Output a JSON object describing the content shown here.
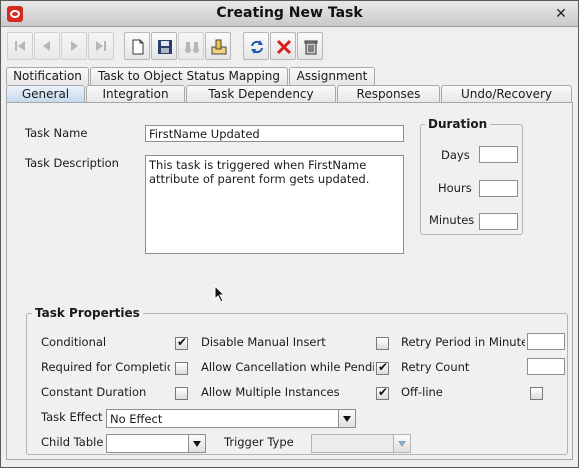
{
  "window": {
    "title": "Creating New Task"
  },
  "toolbar": {
    "buttons": [
      {
        "icon": "first-record-icon"
      },
      {
        "icon": "previous-record-icon"
      },
      {
        "icon": "next-record-icon"
      },
      {
        "icon": "last-record-icon"
      },
      {
        "icon": "new-document-icon"
      },
      {
        "icon": "save-icon"
      },
      {
        "icon": "find-binoculars-icon"
      },
      {
        "icon": "edit-icon"
      },
      {
        "icon": "refresh-icon"
      },
      {
        "icon": "cancel-x-icon"
      },
      {
        "icon": "delete-trash-icon"
      }
    ]
  },
  "tabs": {
    "top_row": [
      "Notification",
      "Task to Object Status Mapping",
      "Assignment"
    ],
    "bottom_row": [
      "General",
      "Integration",
      "Task Dependency",
      "Responses",
      "Undo/Recovery"
    ],
    "active": "General"
  },
  "general": {
    "task_name_label": "Task Name",
    "task_name_value": "FirstName Updated",
    "task_description_label": "Task Description",
    "task_description_value": "This task is triggered when FirstName attribute of parent form gets updated."
  },
  "duration": {
    "title": "Duration",
    "days_label": "Days",
    "hours_label": "Hours",
    "minutes_label": "Minutes",
    "days_value": "",
    "hours_value": "",
    "minutes_value": ""
  },
  "task_properties": {
    "title": "Task Properties",
    "conditional_label": "Conditional",
    "conditional_checked": true,
    "required_label": "Required for Completion",
    "required_checked": false,
    "constant_duration_label": "Constant Duration",
    "constant_duration_checked": false,
    "disable_manual_insert_label": "Disable Manual Insert",
    "disable_manual_insert_checked": false,
    "allow_cancellation_label": "Allow Cancellation while Pending",
    "allow_cancellation_checked": true,
    "allow_multiple_label": "Allow Multiple Instances",
    "allow_multiple_checked": true,
    "retry_period_label": "Retry Period in Minutes",
    "retry_period_value": "",
    "retry_count_label": "Retry Count",
    "retry_count_value": "",
    "offline_label": "Off-line",
    "offline_checked": false,
    "task_effect_label": "Task Effect",
    "task_effect_value": "No Effect",
    "child_table_label": "Child Table",
    "child_table_value": "",
    "trigger_type_label": "Trigger Type",
    "trigger_type_value": "",
    "check_glyph": "✔"
  }
}
